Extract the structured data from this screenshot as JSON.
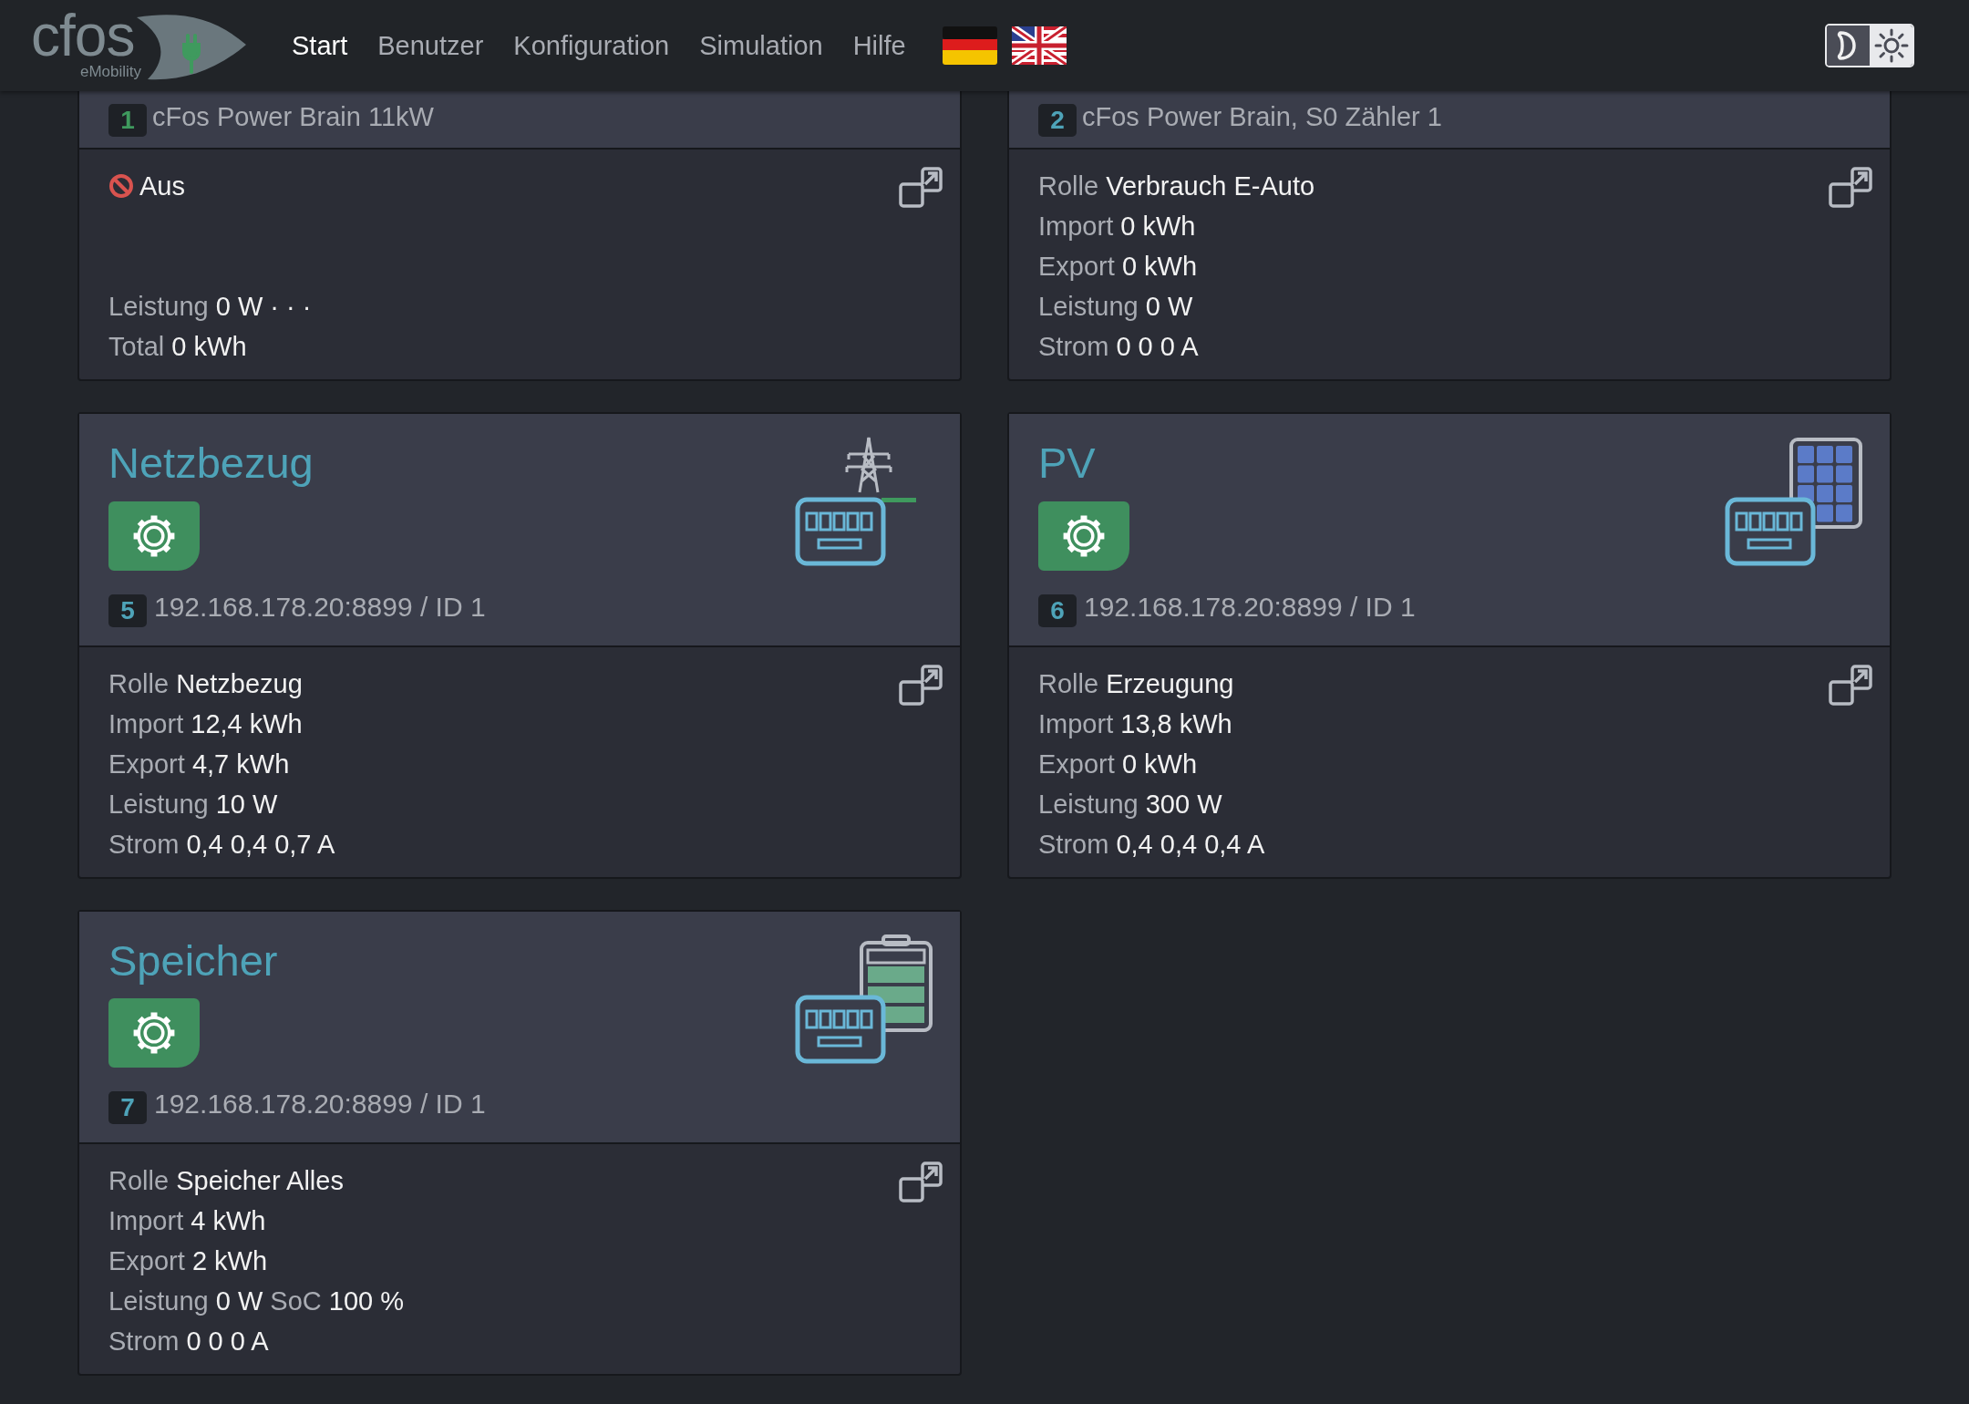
{
  "logo": {
    "name": "cfos",
    "tagline": "eMobility"
  },
  "nav": [
    {
      "label": "Start",
      "selected": true
    },
    {
      "label": "Benutzer",
      "selected": false
    },
    {
      "label": "Konfiguration",
      "selected": false
    },
    {
      "label": "Simulation",
      "selected": false
    },
    {
      "label": "Hilfe",
      "selected": false
    }
  ],
  "languages": [
    {
      "kind": "de"
    },
    {
      "kind": "en"
    }
  ],
  "theme_toggle": [
    {
      "kind": "dark",
      "selected": true
    },
    {
      "kind": "light",
      "selected": false
    }
  ],
  "cards": [
    {
      "kind": "wallbox",
      "badge": {
        "text": "1"
      },
      "title": "cFos Power Brain 11kW",
      "status": {
        "text": "Aus"
      },
      "lines": [
        [
          {
            "label": "Leistung",
            "value": "0 W"
          },
          {
            "value": "· · ·"
          }
        ],
        [
          {
            "label": "Total",
            "value": "0 kWh"
          }
        ]
      ]
    },
    {
      "kind": "counter",
      "badge": {
        "text": "2"
      },
      "title": "cFos Power Brain, S0 Zähler 1",
      "lines": [
        [
          {
            "label": "Rolle",
            "value": "Verbrauch E-Auto"
          }
        ],
        [
          {
            "label": "Import",
            "value": "0 kWh"
          }
        ],
        [
          {
            "label": "Export",
            "value": "0 kWh"
          }
        ],
        [
          {
            "label": "Leistung",
            "value": "0 W"
          }
        ],
        [
          {
            "label": "Strom",
            "value": "0 0 0 A"
          }
        ]
      ]
    },
    {
      "kind": "grid",
      "badge": {
        "text": "5"
      },
      "title": "Netzbezug",
      "address": "192.168.178.20:8899 / ID 1",
      "lines": [
        [
          {
            "label": "Rolle",
            "value": "Netzbezug"
          }
        ],
        [
          {
            "label": "Import",
            "value": "12,4 kWh"
          }
        ],
        [
          {
            "label": "Export",
            "value": "4,7 kWh"
          }
        ],
        [
          {
            "label": "Leistung",
            "value": "10 W"
          }
        ],
        [
          {
            "label": "Strom",
            "value": "0,4 0,4 0,7 A"
          }
        ]
      ]
    },
    {
      "kind": "pv",
      "badge": {
        "text": "6"
      },
      "title": "PV",
      "address": "192.168.178.20:8899 / ID 1",
      "lines": [
        [
          {
            "label": "Rolle",
            "value": "Erzeugung"
          }
        ],
        [
          {
            "label": "Import",
            "value": "13,8 kWh"
          }
        ],
        [
          {
            "label": "Export",
            "value": "0 kWh"
          }
        ],
        [
          {
            "label": "Leistung",
            "value": "300 W"
          }
        ],
        [
          {
            "label": "Strom",
            "value": "0,4 0,4 0,4 A"
          }
        ]
      ]
    },
    {
      "kind": "storage",
      "badge": {
        "text": "7"
      },
      "title": "Speicher",
      "address": "192.168.178.20:8899 / ID 1",
      "lines": [
        [
          {
            "label": "Rolle",
            "value": "Speicher Alles"
          }
        ],
        [
          {
            "label": "Import",
            "value": "4 kWh"
          }
        ],
        [
          {
            "label": "Export",
            "value": "2 kWh"
          }
        ],
        [
          {
            "label": "Leistung",
            "value": "0 W"
          },
          {
            "label": "SoC",
            "value": "100 %"
          }
        ],
        [
          {
            "label": "Strom",
            "value": "0 0 0 A"
          }
        ]
      ]
    }
  ]
}
